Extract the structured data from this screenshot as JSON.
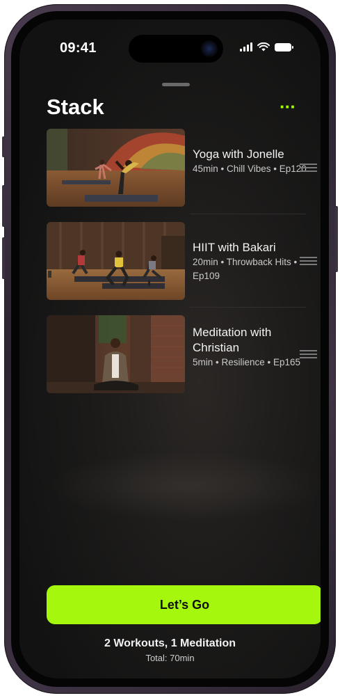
{
  "status_bar": {
    "time": "09:41"
  },
  "header": {
    "title": "Stack",
    "more_label": "···"
  },
  "workouts": [
    {
      "title": "Yoga with Jonelle",
      "meta": "45min • Chill Vibes • Ep120"
    },
    {
      "title": "HIIT with Bakari",
      "meta": "20min • Throwback Hits • Ep109"
    },
    {
      "title": "Meditation with Christian",
      "meta": "5min • Resilience • Ep165"
    }
  ],
  "footer": {
    "cta_label": "Let’s Go",
    "summary": "2 Workouts, 1 Meditation",
    "total": "Total: 70min"
  },
  "colors": {
    "accent": "#a5f80d",
    "background": "#161616"
  },
  "icons": {
    "more": "ellipsis-icon",
    "drag": "reorder-handle-icon"
  }
}
